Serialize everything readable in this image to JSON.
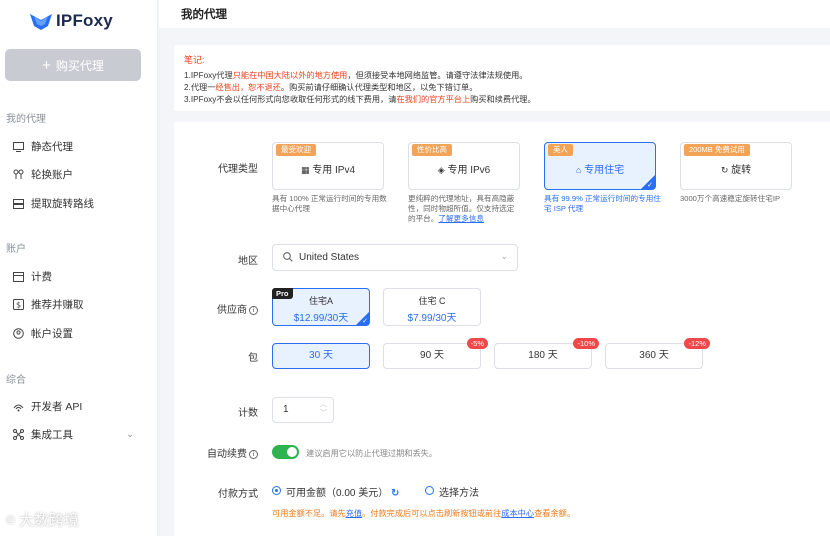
{
  "brand": {
    "name": "IPFoxy"
  },
  "sidebar": {
    "buy_button": "购买代理",
    "sections": [
      {
        "title": "我的代理",
        "items": [
          {
            "label": "静态代理",
            "icon": "monitor-icon"
          },
          {
            "label": "轮换账户",
            "icon": "rotation-icon"
          },
          {
            "label": "提取旋转路线",
            "icon": "server-icon"
          }
        ]
      },
      {
        "title": "账户",
        "items": [
          {
            "label": "计费",
            "icon": "billing-icon"
          },
          {
            "label": "推荐并赚取",
            "icon": "referral-icon"
          },
          {
            "label": "帐户设置",
            "icon": "settings-icon"
          }
        ]
      },
      {
        "title": "综合",
        "items": [
          {
            "label": "开发者 API",
            "icon": "api-icon"
          },
          {
            "label": "集成工具",
            "icon": "tools-icon"
          }
        ]
      }
    ]
  },
  "header": {
    "title": "我的代理"
  },
  "notice": {
    "heading": "笔记:",
    "line1_a": "1.IPFoxy代理",
    "line1_b": "只能在中国大陆以外的地方使用",
    "line1_c": "，但须接受本地网络监管。请遵守法律法规使用。",
    "line2_a": "2.代理一",
    "line2_b": "经售出，恕不退还",
    "line2_c": "。购买前请仔细确认代理类型和地区，以免下错订单。",
    "line3_a": "3.IPFoxy不会以任何形式向您收取任何形式的线下费用，请",
    "line3_b": "在我们的官方平台上",
    "line3_c": "购买和续费代理。"
  },
  "form": {
    "proxy_type_label": "代理类型",
    "proxy_types": [
      {
        "tag": "最受欢迎",
        "title": "专用 IPv4",
        "icon": "grid-icon",
        "desc": "具有 100% 正常运行时间的专用数据中心代理",
        "tag_color": "#f3a356"
      },
      {
        "tag": "性价比高",
        "title": "专用 IPv6",
        "icon": "layers-icon",
        "desc_a": "更纯粹的代理地址，具有高隐蔽性，同时物超所值。仅支持选定的平台。",
        "desc_link": "了解更多信息",
        "tag_color": "#f3a356"
      },
      {
        "tag": "美人",
        "title": "专用住宅",
        "icon": "home-icon",
        "desc": "具有 99.9% 正常运行时间的专用住宅 ISP 代理",
        "tag_color": "#f3a356"
      },
      {
        "tag": "200MB 免费试用",
        "title": "旋转",
        "icon": "rotate-icon",
        "desc": "3000万个高速稳定旋转住宅IP",
        "tag_color": "#f3a356"
      }
    ],
    "region_label": "地区",
    "region_value": "United States",
    "supplier_label": "供应商",
    "suppliers": [
      {
        "badge": "Pro",
        "name": "住宅A",
        "price": "$12.99/30天"
      },
      {
        "name": "住宅 C",
        "price": "$7.99/30天"
      }
    ],
    "package_label": "包",
    "packages": [
      {
        "label": "30 天",
        "discount": ""
      },
      {
        "label": "90 天",
        "discount": "-5%"
      },
      {
        "label": "180 天",
        "discount": "-10%"
      },
      {
        "label": "360 天",
        "discount": "-12%"
      }
    ],
    "count_label": "计数",
    "count_value": "1",
    "auto_renew_label": "自动续费",
    "auto_renew_on": true,
    "auto_renew_hint": "建议启用它以防止代理过期和丢失。",
    "payment_label": "付款方式",
    "payment_option1": "可用金额",
    "payment_option1_amount": "（0.00 美元）",
    "payment_option2": "选择方法",
    "warn_a": "可用金额不足。请先",
    "warn_link1": "充值",
    "warn_b": "。付款完成后可以点击刷新按钮或前往",
    "warn_link2": "成本中心",
    "warn_c": "查看余额。"
  },
  "watermark": "大数跨境",
  "colors": {
    "accent": "#2a6ef5",
    "toggle": "#2fb350",
    "danger": "#f04848",
    "warning": "#f07a1a"
  }
}
